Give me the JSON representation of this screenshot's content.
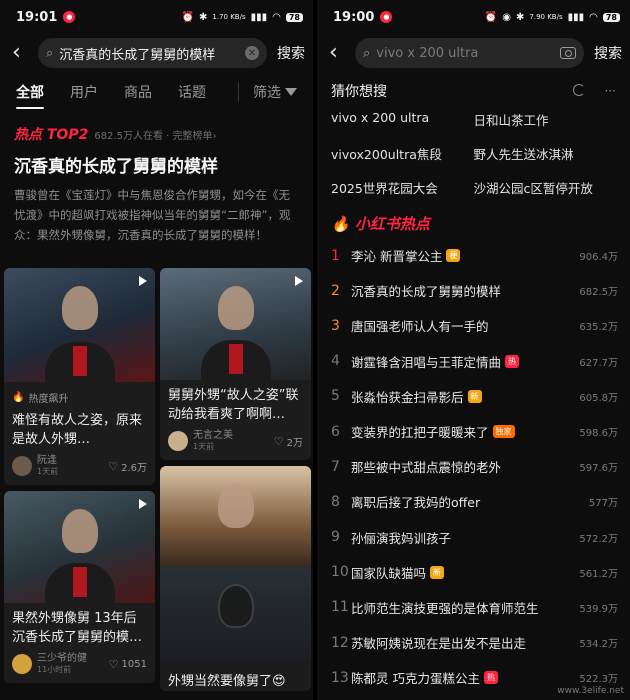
{
  "left": {
    "status": {
      "time": "19:01",
      "network": "1.70 KB/s",
      "battery": "78"
    },
    "search": {
      "value": "沉香真的长成了舅舅的模样",
      "button": "搜索"
    },
    "tabs": [
      "全部",
      "用户",
      "商品",
      "话题"
    ],
    "filter_label": "筛选",
    "hot": {
      "badge": "热点 TOP2",
      "meta": "682.5万人在看 · 完整榜单›",
      "title": "沉香真的长成了舅舅的模样",
      "desc": "曹骏曾在《宝莲灯》中与焦恩俊合作舅甥，如今在《无忧渡》中的超飒打戏被指神似当年的舅舅“二郎神”，观众：果然外甥像舅，沉香真的长成了舅舅的模样！"
    },
    "cards": [
      {
        "tag": "热度飙升",
        "title": "难怪有故人之姿，原来是故人外甥…",
        "author": "阮逢",
        "time": "1天前",
        "likes": "2.6万"
      },
      {
        "title": "舅舅外甥“故人之姿”联动给我看爽了啊啊…",
        "author": "无言之美",
        "time": "1天前",
        "likes": "2万"
      },
      {
        "title": "果然外甥像舅 13年后沉香长成了舅舅的模…",
        "author": "三少爷的健",
        "time": "11小时前",
        "likes": "1051"
      },
      {
        "title": "外甥当然要像舅了😍"
      }
    ]
  },
  "right": {
    "status": {
      "time": "19:00",
      "network": "7.90 KB/s",
      "battery": "78"
    },
    "search": {
      "placeholder": "vivo x 200 ultra",
      "button": "搜索"
    },
    "guess_title": "猜你想搜",
    "guess": [
      "vivo x 200 ultra",
      "日和山茶工作",
      "vivox200ultra焦段",
      "野人先生送冰淇淋",
      "2025世界花园大会",
      "沙湖公园c区暂停开放"
    ],
    "brand": "小红书热点",
    "ranks": [
      {
        "n": "1",
        "text": "李沁 新晋掌公主",
        "badge": "梗",
        "badge_type": "gold",
        "count": "906.4万"
      },
      {
        "n": "2",
        "text": "沉香真的长成了舅舅的模样",
        "badge": "",
        "badge_type": "",
        "count": "682.5万"
      },
      {
        "n": "3",
        "text": "唐国强老师认人有一手的",
        "badge": "",
        "badge_type": "",
        "count": "635.2万"
      },
      {
        "n": "4",
        "text": "谢霆锋含泪唱与王菲定情曲",
        "badge": "热",
        "badge_type": "hot",
        "count": "627.7万"
      },
      {
        "n": "5",
        "text": "张淼怡获金扫帚影后",
        "badge": "新",
        "badge_type": "new",
        "count": "605.8万"
      },
      {
        "n": "6",
        "text": "变装界的扛把子暖暖来了",
        "badge": "独家",
        "badge_type": "ex",
        "count": "598.6万"
      },
      {
        "n": "7",
        "text": "那些被中式甜点震惊的老外",
        "badge": "",
        "badge_type": "",
        "count": "597.6万"
      },
      {
        "n": "8",
        "text": "离职后接了我妈的offer",
        "badge": "",
        "badge_type": "",
        "count": "577万"
      },
      {
        "n": "9",
        "text": "孙俪演我妈训孩子",
        "badge": "",
        "badge_type": "",
        "count": "572.2万"
      },
      {
        "n": "10",
        "text": "国家队缺猫吗",
        "badge": "新",
        "badge_type": "new",
        "count": "561.2万"
      },
      {
        "n": "11",
        "text": "比师范生演技更强的是体育师范生",
        "badge": "",
        "badge_type": "",
        "count": "539.9万"
      },
      {
        "n": "12",
        "text": "苏敏阿姨说现在是出发不是出走",
        "badge": "",
        "badge_type": "",
        "count": "534.2万"
      },
      {
        "n": "13",
        "text": "陈都灵 巧克力蛋糕公主",
        "badge": "热",
        "badge_type": "hot",
        "count": "522.3万"
      }
    ],
    "watermark": "www.3elife.net"
  }
}
